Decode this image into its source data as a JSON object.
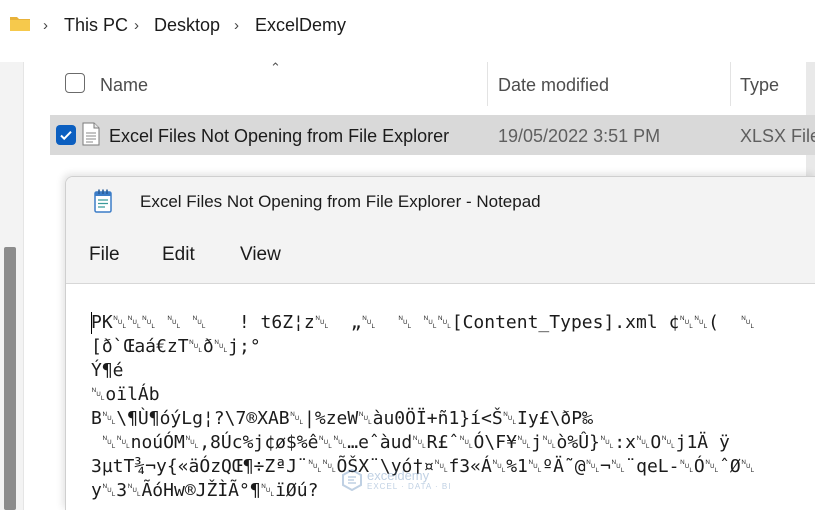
{
  "explorer": {
    "breadcrumb": [
      "This PC",
      "Desktop",
      "ExcelDemy"
    ],
    "columns": {
      "name": "Name",
      "date": "Date modified",
      "type": "Type"
    },
    "file": {
      "name": "Excel Files Not Opening from File Explorer",
      "date": "19/05/2022 3:51 PM",
      "type": "XLSX File",
      "selected": true
    }
  },
  "notepad": {
    "title": "Excel Files Not Opening from File Explorer - Notepad",
    "menu": [
      "File",
      "Edit",
      "View"
    ],
    "lines": [
      "PK␀␀␀ ␀ ␀   ! t6Z¦z␀  „␀  ␀ ␀␀[Content_Types].xml ¢␀␀(  ␀",
      "[ð`Œaá€zT␀ð␀j;°",
      "Ý¶é",
      "␀oïlÁb",
      "B␀\\¶Ù¶óýLg¦?\\7®XAB␀|%zeW␀àu0ÖÏ+ñ1}í<Š␀Iy£\\ðP‰",
      " ␀␀noúÓM␀,8Úc%j¢ø$%ê␀␀…eˆàud␀R£ˆ␀Ó\\F¥␀j␀ò%Û}␀:x␀O␀j1Ä ÿ",
      "3µtT¾¬y{«äÓzQŒ¶÷ZªJ¨␀␀ÕŠX¨\\yó†¤␀f3«Á␀%1␀ºÄ˜@␀¬␀¨qeL-␀Ó␀ˆØ␀",
      "y␀3␀ÃóHw®JŽÌÃ°¶␀ïØú?"
    ]
  },
  "watermark": {
    "name": "exceldemy",
    "tagline": "EXCEL · DATA · BI"
  }
}
